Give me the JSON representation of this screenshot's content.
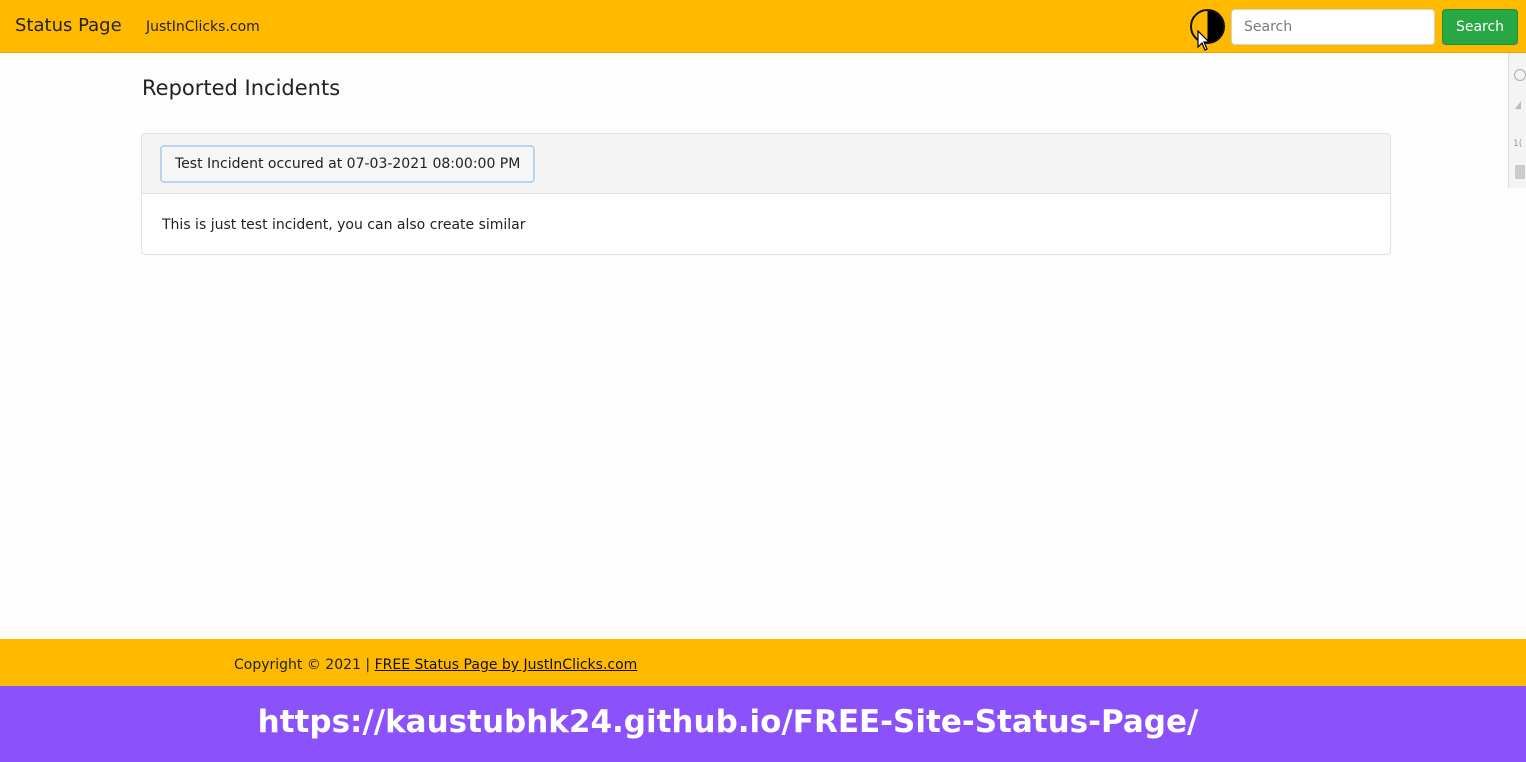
{
  "navbar": {
    "brand": "Status Page",
    "link": "JustInClicks.com",
    "theme_toggle_icon": "contrast-icon",
    "search": {
      "placeholder": "Search",
      "value": "",
      "button_label": "Search"
    },
    "colors": {
      "background": "#ffba00",
      "search_button": "#28a745"
    }
  },
  "main": {
    "title": "Reported Incidents",
    "incidents": [
      {
        "header": "Test Incident occured at 07-03-2021 08:00:00 PM",
        "body": "This is just test incident, you can also create similar"
      }
    ]
  },
  "footer": {
    "copyright": "Copyright © 2021 | ",
    "link_text": "FREE Status Page by JustInClicks.com"
  },
  "banner": {
    "url": "https://kaustubhk24.github.io/FREE-Site-Status-Page/",
    "color": "#8b51fb"
  }
}
